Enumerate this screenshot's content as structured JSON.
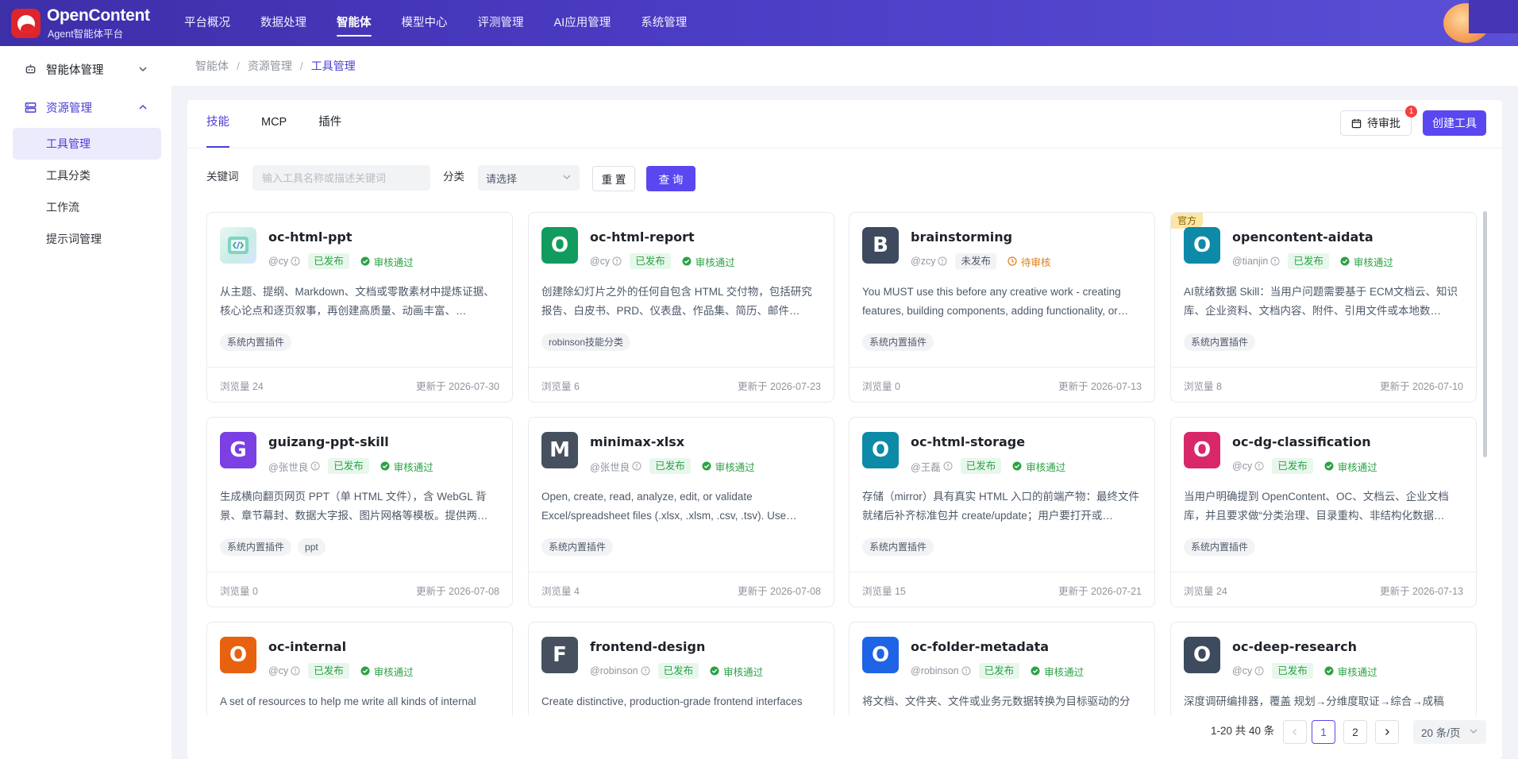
{
  "brand": {
    "name": "OpenContent",
    "subtitle": "Agent智能体平台"
  },
  "topnav": [
    {
      "label": "平台概况"
    },
    {
      "label": "数据处理"
    },
    {
      "label": "智能体",
      "active": true
    },
    {
      "label": "模型中心"
    },
    {
      "label": "评测管理"
    },
    {
      "label": "AI应用管理"
    },
    {
      "label": "系统管理"
    }
  ],
  "sidebar": {
    "groups": [
      {
        "label": "智能体管理",
        "icon": "robot-icon",
        "expanded": false
      },
      {
        "label": "资源管理",
        "icon": "server-icon",
        "expanded": true
      }
    ],
    "subitems": [
      {
        "label": "工具管理",
        "active": true
      },
      {
        "label": "工具分类"
      },
      {
        "label": "工作流"
      },
      {
        "label": "提示词管理"
      }
    ]
  },
  "breadcrumb": [
    "智能体",
    "资源管理",
    "工具管理"
  ],
  "tabs": [
    {
      "label": "技能",
      "active": true
    },
    {
      "label": "MCP"
    },
    {
      "label": "插件"
    }
  ],
  "actions": {
    "pending_label": "待审批",
    "pending_count": "1",
    "create_label": "创建工具"
  },
  "filters": {
    "keyword_label": "关键词",
    "keyword_placeholder": "输入工具名称或描述关键词",
    "keyword_value": "",
    "category_label": "分类",
    "category_value": "请选择",
    "reset_label": "重 置",
    "query_label": "查 询"
  },
  "cards": [
    {
      "title": "oc-html-ppt",
      "icon_letter": "",
      "icon_kind": "image",
      "icon_color": "#d8f1ec",
      "author": "@cy",
      "status": "已发布",
      "review": "审核通过",
      "review_state": "ok",
      "desc": "从主题、提纲、Markdown、文档或零散素材中提炼证据、核心论点和逐页叙事，再创建高质量、动画丰富、…",
      "tags": [
        "系统内置插件"
      ],
      "views": "浏览量 24",
      "updated": "更新于 2026-07-30",
      "official": false
    },
    {
      "title": "oc-html-report",
      "icon_letter": "O",
      "icon_kind": "letter",
      "icon_color": "#129b5e",
      "author": "@cy",
      "status": "已发布",
      "review": "审核通过",
      "review_state": "ok",
      "desc": "创建除幻灯片之外的任何自包含 HTML 交付物，包括研究报告、白皮书、PRD、仪表盘、作品集、简历、邮件…",
      "tags": [
        "robinson技能分类"
      ],
      "views": "浏览量 6",
      "updated": "更新于 2026-07-23",
      "official": false
    },
    {
      "title": "brainstorming",
      "icon_letter": "B",
      "icon_kind": "letter",
      "icon_color": "#3e4a5d",
      "author": "@zcy",
      "status": "未发布",
      "review": "待审核",
      "review_state": "wait",
      "desc": "You MUST use this before any creative work - creating features, building components, adding functionality, or…",
      "tags": [
        "系统内置插件"
      ],
      "views": "浏览量 0",
      "updated": "更新于 2026-07-13",
      "official": false
    },
    {
      "title": "opencontent-aidata",
      "icon_letter": "O",
      "icon_kind": "letter",
      "icon_color": "#0d8aa8",
      "author": "@tianjin",
      "status": "已发布",
      "review": "审核通过",
      "review_state": "ok",
      "desc": "AI就绪数据 Skill：当用户问题需要基于 ECM文档云、知识库、企业资料、文档内容、附件、引用文件或本地数…",
      "tags": [
        "系统内置插件"
      ],
      "views": "浏览量 8",
      "updated": "更新于 2026-07-10",
      "official": true,
      "official_label": "官方"
    },
    {
      "title": "guizang-ppt-skill",
      "icon_letter": "G",
      "icon_kind": "letter",
      "icon_color": "#7b3fe4",
      "author": "@张世良",
      "status": "已发布",
      "review": "审核通过",
      "review_state": "ok",
      "desc": "生成横向翻页网页 PPT（单 HTML 文件），含 WebGL 背景、章节幕封、数据大字报、图片网格等模板。提供两…",
      "tags": [
        "系统内置插件",
        "ppt"
      ],
      "views": "浏览量 0",
      "updated": "更新于 2026-07-08",
      "official": false
    },
    {
      "title": "minimax-xlsx",
      "icon_letter": "M",
      "icon_kind": "letter",
      "icon_color": "#46505f",
      "author": "@张世良",
      "status": "已发布",
      "review": "审核通过",
      "review_state": "ok",
      "desc": "Open, create, read, analyze, edit, or validate Excel/spreadsheet files (.xlsx, .xlsm, .csv, .tsv). Use when…",
      "tags": [
        "系统内置插件"
      ],
      "views": "浏览量 4",
      "updated": "更新于 2026-07-08",
      "official": false
    },
    {
      "title": "oc-html-storage",
      "icon_letter": "O",
      "icon_kind": "letter",
      "icon_color": "#0d8aa8",
      "author": "@王磊",
      "status": "已发布",
      "review": "审核通过",
      "review_state": "ok",
      "desc": "存储（mirror）具有真实 HTML 入口的前端产物：最终文件就绪后补齐标准包并 create/update；用户要打开或…",
      "tags": [
        "系统内置插件"
      ],
      "views": "浏览量 15",
      "updated": "更新于 2026-07-21",
      "official": false
    },
    {
      "title": "oc-dg-classification",
      "icon_letter": "O",
      "icon_kind": "letter",
      "icon_color": "#d9286a",
      "author": "@cy",
      "status": "已发布",
      "review": "审核通过",
      "review_state": "ok",
      "desc": "当用户明确提到 OpenContent、OC、文档云、企业文档库，并且要求做“分类治理、目录重构、非结构化数据…",
      "tags": [
        "系统内置插件"
      ],
      "views": "浏览量 24",
      "updated": "更新于 2026-07-13",
      "official": false
    },
    {
      "title": "oc-internal",
      "icon_letter": "O",
      "icon_kind": "letter",
      "icon_color": "#e8610f",
      "author": "@cy",
      "status": "已发布",
      "review": "审核通过",
      "review_state": "ok",
      "desc": "A set of resources to help me write all kinds of internal",
      "tags": [],
      "views": "",
      "updated": "",
      "official": false
    },
    {
      "title": "frontend-design",
      "icon_letter": "F",
      "icon_kind": "letter",
      "icon_color": "#46505f",
      "author": "@robinson",
      "status": "已发布",
      "review": "审核通过",
      "review_state": "ok",
      "desc": "Create distinctive, production-grade frontend interfaces",
      "tags": [],
      "views": "",
      "updated": "",
      "official": false
    },
    {
      "title": "oc-folder-metadata",
      "icon_letter": "O",
      "icon_kind": "letter",
      "icon_color": "#1f63e6",
      "author": "@robinson",
      "status": "已发布",
      "review": "审核通过",
      "review_state": "ok",
      "desc": "将文档、文件夹、文件或业务元数据转换为目标驱动的分",
      "tags": [],
      "views": "",
      "updated": "",
      "official": false
    },
    {
      "title": "oc-deep-research",
      "icon_letter": "O",
      "icon_kind": "letter",
      "icon_color": "#3e4a5d",
      "author": "@cy",
      "status": "已发布",
      "review": "审核通过",
      "review_state": "ok",
      "desc": "深度调研编排器，覆盖 规划→分维度取证→综合→成稿",
      "tags": [],
      "views": "",
      "updated": "",
      "official": false
    }
  ],
  "pagination": {
    "total_text": "1-20 共 40 条",
    "pages": [
      "1",
      "2"
    ],
    "current": "1",
    "page_size": "20 条/页"
  },
  "colors": {
    "accent": "#5a47f0",
    "topbar": "#4b3cc4",
    "published_bg": "#e8f7ec",
    "published_fg": "#2ba245",
    "pending_fg": "#e27d12"
  }
}
